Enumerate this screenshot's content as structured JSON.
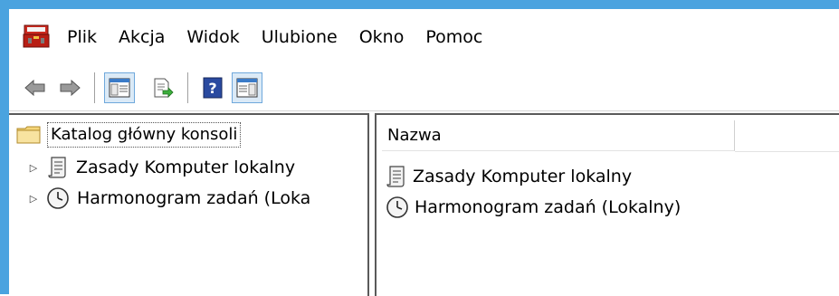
{
  "colors": {
    "window_border": "#4aa3df",
    "pane_border": "#5a5a5a",
    "pressed_button_bg": "#dbeaf7",
    "pressed_button_border": "#6fa8dc"
  },
  "menubar": {
    "app_icon": "toolbox-icon",
    "items": [
      {
        "label": "Plik"
      },
      {
        "label": "Akcja"
      },
      {
        "label": "Widok"
      },
      {
        "label": "Ulubione"
      },
      {
        "label": "Okno"
      },
      {
        "label": "Pomoc"
      }
    ]
  },
  "toolbar": {
    "buttons": [
      {
        "icon": "back-arrow-icon"
      },
      {
        "icon": "forward-arrow-icon"
      },
      {
        "icon": "show-hide-console-tree-icon",
        "pressed": true
      },
      {
        "icon": "export-list-icon"
      },
      {
        "icon": "help-icon"
      },
      {
        "icon": "show-hide-action-pane-icon",
        "pressed": true
      }
    ]
  },
  "tree": {
    "root": {
      "label": "Katalog główny konsoli",
      "icon": "folder-icon"
    },
    "items": [
      {
        "label": "Zasady Komputer lokalny",
        "icon": "policy-scroll-icon"
      },
      {
        "label": "Harmonogram zadań (Loka",
        "icon": "clock-icon"
      }
    ]
  },
  "list": {
    "columns": [
      {
        "label": "Nazwa"
      }
    ],
    "rows": [
      {
        "label": "Zasady Komputer lokalny",
        "icon": "policy-scroll-icon"
      },
      {
        "label": "Harmonogram zadań (Lokalny)",
        "icon": "clock-icon"
      }
    ]
  }
}
